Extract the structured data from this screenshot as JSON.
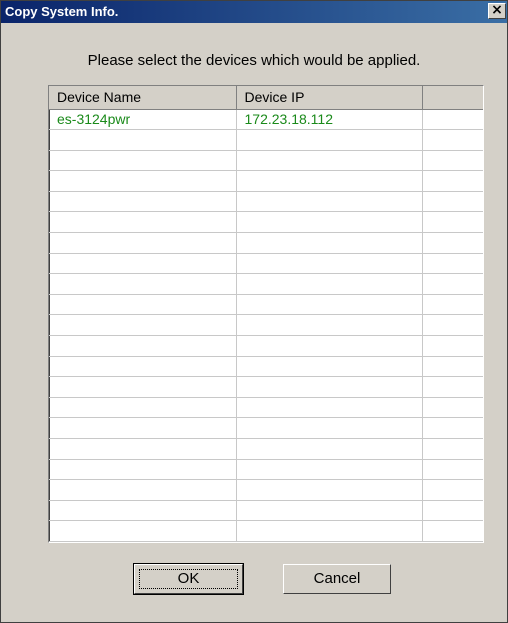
{
  "window": {
    "title": "Copy System Info.",
    "close_label": "×"
  },
  "instruction": "Please select the devices which would be applied.",
  "table": {
    "columns": [
      "Device Name",
      "Device IP",
      ""
    ],
    "rows": [
      [
        "es-3124pwr",
        "172.23.18.112",
        ""
      ]
    ],
    "empty_rows": 20
  },
  "buttons": {
    "ok_label": "OK",
    "cancel_label": "Cancel"
  },
  "colors": {
    "row_text": "#1a8a1a",
    "titlebar": "#0a246a",
    "dialog_bg": "#d4d0c8"
  }
}
